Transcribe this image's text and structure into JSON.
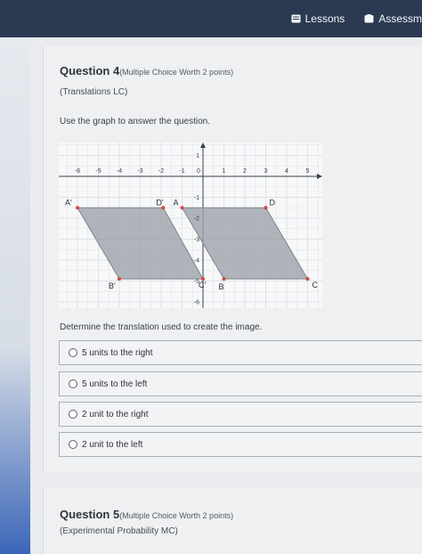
{
  "nav": {
    "lessons_label": "Lessons",
    "assessments_label": "Assessm"
  },
  "question4": {
    "title": "Question 4",
    "worth": "(Multiple Choice Worth 2 points)",
    "topic": "(Translations LC)",
    "instruction": "Use the graph to answer the question.",
    "prompt": "Determine the translation used to create the image.",
    "options": [
      "5 units to the right",
      "5 units to the left",
      "2 unit to the right",
      "2 unit to the left"
    ]
  },
  "question5": {
    "title": "Question 5",
    "worth": "(Multiple Choice Worth 2 points)",
    "topic": "(Experimental Probability MC)"
  },
  "graph": {
    "x_ticks": [
      "-6",
      "-5",
      "-4",
      "-3",
      "-2",
      "-1",
      "0",
      "1",
      "2",
      "3",
      "4",
      "5"
    ],
    "y_ticks": [
      "1",
      "-1",
      "-2",
      "-3",
      "-4",
      "-5",
      "-6"
    ],
    "image_labels": [
      "A'",
      "D'",
      "B'",
      "C'"
    ],
    "original_labels": [
      "A",
      "D",
      "B",
      "C"
    ],
    "fill_color": "#9ca3ab",
    "point_color": "#d8453d"
  }
}
